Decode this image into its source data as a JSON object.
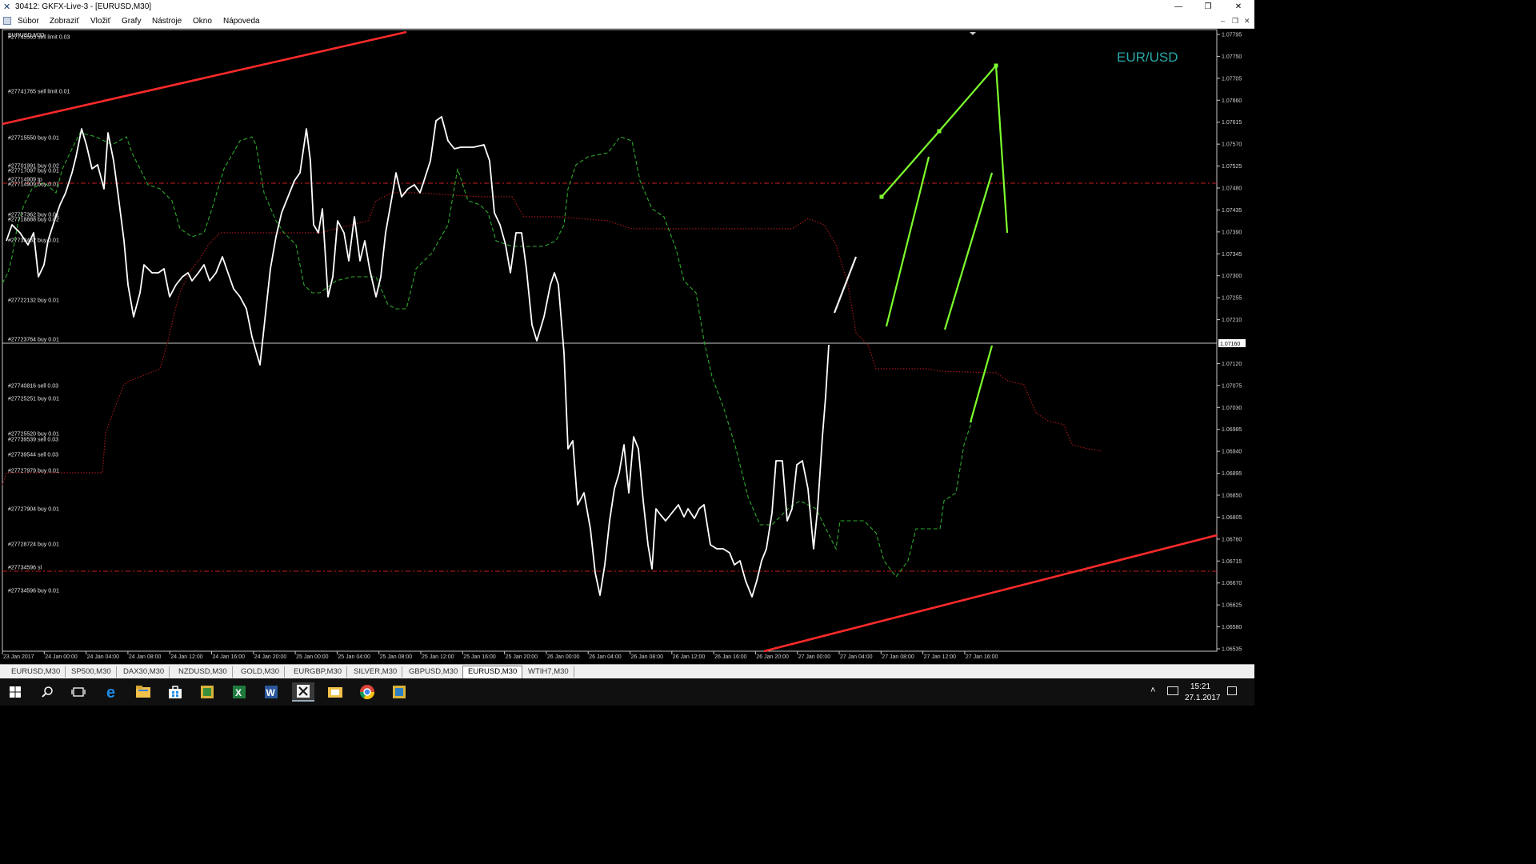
{
  "window": {
    "title": "30412: GKFX-Live-3 - [EURUSD,M30]",
    "minimize": "—",
    "restore": "❐",
    "close": "✕",
    "app_icon": "metatrader-logo-icon"
  },
  "menu": {
    "items": [
      "Súbor",
      "Zobraziť",
      "Vložiť",
      "Grafy",
      "Nástroje",
      "Okno",
      "Nápoveda"
    ],
    "mdi_minimize": "–",
    "mdi_restore": "❐",
    "mdi_close": "✕"
  },
  "chart": {
    "symbol_label": "EURUSD,M30",
    "watermark": "EUR/USD",
    "current_price": "1.07160",
    "price_ticks": [
      "1.07795",
      "1.07750",
      "1.07705",
      "1.07660",
      "1.07615",
      "1.07570",
      "1.07525",
      "1.07480",
      "1.07435",
      "1.07390",
      "1.07345",
      "1.07300",
      "1.07255",
      "1.07210",
      "1.07120",
      "1.07075",
      "1.07030",
      "1.06985",
      "1.06940",
      "1.06895",
      "1.06850",
      "1.06805",
      "1.06760",
      "1.06715",
      "1.06670",
      "1.06625",
      "1.06580",
      "1.06535"
    ],
    "time_ticks": [
      "23 Jan 2017",
      "24 Jan 00:00",
      "24 Jan 04:00",
      "24 Jan 08:00",
      "24 Jan 12:00",
      "24 Jan 16:00",
      "24 Jan 20:00",
      "25 Jan 00:00",
      "25 Jan 04:00",
      "25 Jan 08:00",
      "25 Jan 12:00",
      "25 Jan 16:00",
      "25 Jan 20:00",
      "26 Jan 00:00",
      "26 Jan 04:00",
      "26 Jan 08:00",
      "26 Jan 12:00",
      "26 Jan 16:00",
      "26 Jan 20:00",
      "27 Jan 00:00",
      "27 Jan 04:00",
      "27 Jan 08:00",
      "27 Jan 12:00",
      "27 Jan 16:00"
    ],
    "order_labels": [
      "#27745565 sell limit 0.03",
      "#27741765 sell limit 0.01",
      "#27715550 buy 0.01",
      "#27701991 buy 0.02",
      "#27717097 buy 0.01",
      "#27714909 tp",
      "#27714909 buy 0.01",
      "#27727362 buy 0.01",
      "#27718888 buy 0.02",
      "#27733432 buy 0.01",
      "#27722132 buy 0.01",
      "#27723764 buy 0.01",
      "#27740816 sell 0.03",
      "#27725251 buy 0.01",
      "#27725520 buy 0.01",
      "#27739539 sell 0.03",
      "#27739544 sell 0.03",
      "#27727979 buy 0.01",
      "#27727904 buy 0.01",
      "#27728724 buy 0.01",
      "#27734596 sl",
      "#27734596 buy 0.01"
    ],
    "colors": {
      "background": "#000000",
      "price": "#ffffff",
      "trendline": "#ff2a2a",
      "order_line": "#c81e1e",
      "indicator_green": "#2ea82e",
      "indicator_red": "#a01818",
      "drawing": "#7dff2e",
      "watermark": "#2aa8a8"
    }
  },
  "tabs": [
    {
      "label": "EURUSD,M30",
      "active": false
    },
    {
      "label": "SP500,M30",
      "active": false
    },
    {
      "label": "DAX30,M30",
      "active": false
    },
    {
      "label": "NZDUSD,M30",
      "active": false
    },
    {
      "label": "GOLD,M30",
      "active": false
    },
    {
      "label": "EURGBP,M30",
      "active": false
    },
    {
      "label": "SILVER,M30",
      "active": false
    },
    {
      "label": "GBPUSD,M30",
      "active": false
    },
    {
      "label": "EURUSD,M30",
      "active": true
    },
    {
      "label": "WTIH7,M30",
      "active": false
    }
  ],
  "taskbar": {
    "icons": [
      "start-windows-icon",
      "search-icon",
      "task-view-icon",
      "edge-icon",
      "file-explorer-icon",
      "store-icon",
      "app-icon",
      "excel-icon",
      "word-icon",
      "metatrader-icon",
      "mail-folder-icon",
      "chrome-icon",
      "app-icon"
    ],
    "time": "15:21",
    "date": "27.1.2017",
    "tray_up": "˄"
  }
}
